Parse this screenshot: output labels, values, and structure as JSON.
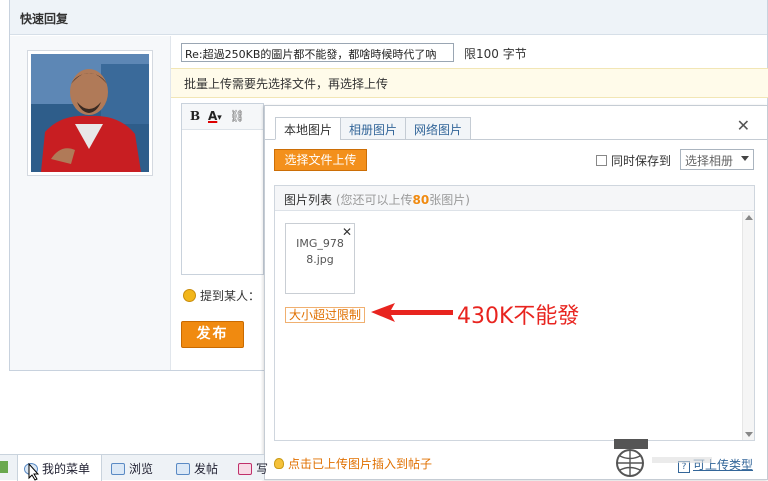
{
  "quick_reply": {
    "title": "快速回复",
    "subject_value": "Re:超過250KB的圖片都不能發，都啥時候時代了吶",
    "limit_prefix": "限",
    "limit_num": "100",
    "limit_suffix": " 字节",
    "notice": "批量上传需要先选择文件，再选择上传",
    "toolbar": {
      "bold": "B",
      "font_color": "A",
      "font_color_arrow": "▾",
      "link": "⛓"
    },
    "mention_label": "提到某人：",
    "publish_label": "发布"
  },
  "upload_dialog": {
    "tabs": [
      "本地图片",
      "相册图片",
      "网络图片"
    ],
    "close": "✕",
    "choose_button": "选择文件上传",
    "save_to_label": "同时保存到",
    "album_select": "选择相册",
    "list_title": "图片列表",
    "list_hint_prefix": " (您还可以上传",
    "list_hint_count": "80",
    "list_hint_suffix": "张图片)",
    "thumb_name_line1": "IMG_978",
    "thumb_name_line2": "8.jpg",
    "thumb_remove": "✕",
    "size_error": "大小超过限制",
    "annotation": "430K不能發",
    "insert_link": "点击已上传图片插入到帖子",
    "types_link": "可上传类型",
    "types_icon": "?"
  },
  "bottom_bar": {
    "items": [
      "我的菜单",
      "浏览",
      "发帖",
      "写"
    ]
  },
  "colors": {
    "accent_orange": "#f08a10",
    "annotation_red": "#e8241f",
    "link_blue": "#336699"
  }
}
